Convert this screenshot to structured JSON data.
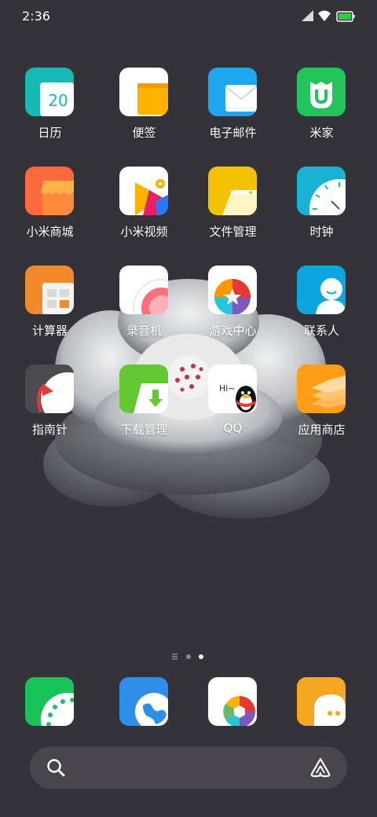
{
  "status_bar": {
    "time": "2:36",
    "icons": [
      "cellular-signal-icon",
      "wifi-icon",
      "battery-icon"
    ],
    "battery_color": "#2ecc40"
  },
  "apps": [
    {
      "name": "calendar",
      "label": "日历",
      "icon_text": "20"
    },
    {
      "name": "notes",
      "label": "便签"
    },
    {
      "name": "email",
      "label": "电子邮件"
    },
    {
      "name": "mijia",
      "label": "米家"
    },
    {
      "name": "mi-store",
      "label": "小米商城"
    },
    {
      "name": "mi-video",
      "label": "小米视频"
    },
    {
      "name": "file-manager",
      "label": "文件管理"
    },
    {
      "name": "clock",
      "label": "时钟"
    },
    {
      "name": "calculator",
      "label": "计算器"
    },
    {
      "name": "recorder",
      "label": "录音机"
    },
    {
      "name": "game-center",
      "label": "游戏中心"
    },
    {
      "name": "contacts",
      "label": "联系人"
    },
    {
      "name": "compass",
      "label": "指南针"
    },
    {
      "name": "downloads",
      "label": "下载管理"
    },
    {
      "name": "qq",
      "label": "QQ",
      "icon_text": "Hi~"
    },
    {
      "name": "app-store",
      "label": "应用商店"
    }
  ],
  "page_indicator": {
    "pages": 2,
    "current": 2,
    "has_feed_page": true
  },
  "dock": [
    "phone-icon",
    "browser-icon",
    "camera-icon",
    "messages-icon"
  ],
  "search": {
    "icon": "search-icon",
    "assistant_icon": "assistant-icon"
  }
}
